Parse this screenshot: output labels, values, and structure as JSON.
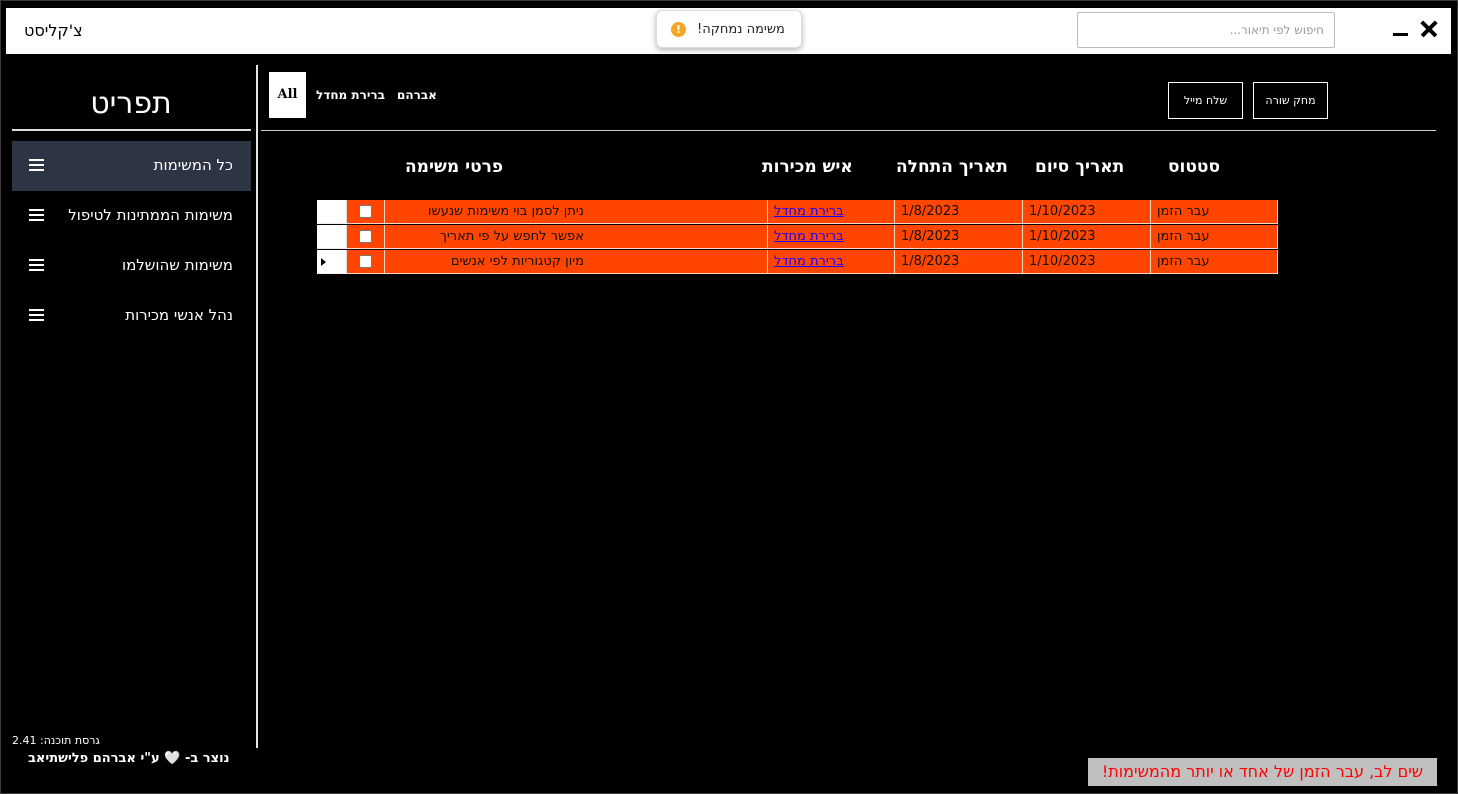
{
  "app": {
    "title": "צ'קליסט",
    "search_placeholder": "חיפוש לפי תיאור..."
  },
  "toast": {
    "text": "!משימה נמחקה",
    "icon": "warning-circle-icon",
    "icon_glyph": "!"
  },
  "sidebar": {
    "title": "תפריט",
    "items": [
      {
        "label": "כל המשימות"
      },
      {
        "label": "משימות הממתינות לטיפול"
      },
      {
        "label": "משימות שהושלמו"
      },
      {
        "label": "נהל אנשי מכירות"
      }
    ],
    "version": "גרסת תוכנה: 2.41",
    "credit": "נוצר ב- 🤍 ע\"י אברהם פלישתיאב"
  },
  "filters": {
    "all": "All",
    "tabs": [
      "ברירת מחדל",
      "אברהם"
    ]
  },
  "actions": {
    "delete_row": "מחק שורה",
    "send_mail": "שלח מייל"
  },
  "table": {
    "headers": {
      "status": "סטטוס",
      "end_date": "תאריך סיום",
      "start_date": "תאריך התחלה",
      "salesperson": "איש מכירות",
      "details": "פרטי משימה"
    },
    "rows": [
      {
        "details": "ניתן לסמן בוי משימות שנעשו",
        "salesperson": "ברירת מחדל",
        "start": "1/8/2023",
        "end": "1/10/2023",
        "status": "עבר הזמן",
        "checked": false
      },
      {
        "details": "אפשר לחפש על פי תאריך",
        "salesperson": "ברירת מחדל",
        "start": "1/8/2023",
        "end": "1/10/2023",
        "status": "עבר הזמן",
        "checked": false
      },
      {
        "details": "מיון קטגוריות לפי אנשים",
        "salesperson": "ברירת מחדל",
        "start": "1/8/2023",
        "end": "1/10/2023",
        "status": "עבר הזמן",
        "checked": false
      }
    ]
  },
  "warning": "שים לב, עבר הזמן של אחד או יותר מהמשימות!",
  "colors": {
    "row_overdue": "#ff4500",
    "sidebar_active": "#2d3444",
    "link": "#1a00ff",
    "warning_text": "#ff0000"
  }
}
